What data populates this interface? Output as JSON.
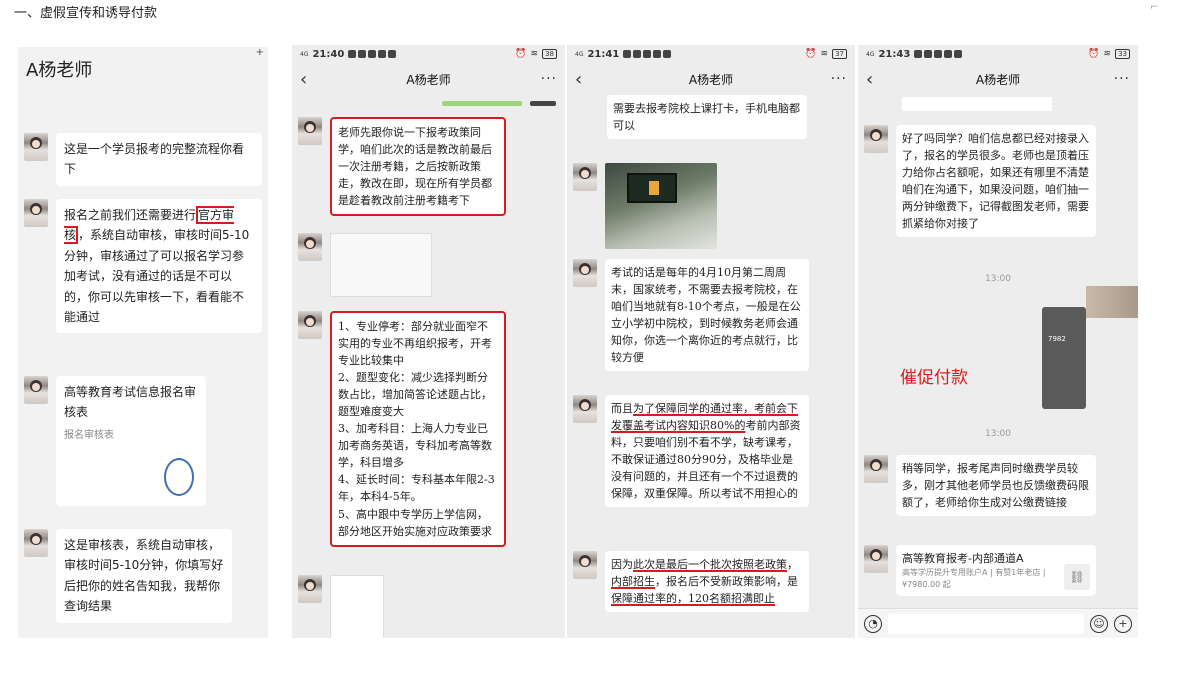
{
  "page_heading": "一、虚假宣传和诱导付款",
  "chat_title": "A杨老师",
  "panel1": {
    "messages": [
      "这是一个学员报考的完整流程你看下",
      "报名之前我们还需要进行",
      "官方审核",
      "，系统自动审核，审核时间5-10分钟，审核通过了可以报名学习参加考试，没有通过的话是不可以的，你可以先审核一下，看看能不能通过",
      "这是审核表，系统自动审核，审核时间5-10分钟，你填写好后把你的姓名告知我，我帮你查询结果"
    ],
    "card_title": "高等教育考试信息报名审核表",
    "card_sub": "报名审核表"
  },
  "panel2": {
    "time": "21:40",
    "battery": "38",
    "msg1": "老师先跟你说一下报考政策同学，咱们此次的话是教改前最后一次注册考籍，之后按新政策走，教改在即，现在所有学员都是趁着教改前注册考籍考下",
    "msg2": "1、专业停考：部分就业面窄不实用的专业不再组织报考，开考专业比较集中\n2、题型变化：减少选择判断分数占比，增加简答论述题占比，题型难度变大\n3、加考科目：上海人力专业已加考商务英语，专科加考高等数学，科目增多\n4、延长时间：专科基本年限2-3年，本科4-5年。\n5、高中跟中专学历上学信网，部分地区开始实施对应政策要求"
  },
  "panel3": {
    "time": "21:41",
    "battery": "37",
    "msg0": "需要去报考院校上课打卡，手机电脑都可以",
    "msg1": "考试的话是每年的4月10月第二周周末，国家统考，不需要去报考院校，在咱们当地就有8-10个考点，一般是在公立小学初中院校，到时候教务老师会通知你，你选一个离你近的考点就行，比较方便",
    "msg2a": "而且",
    "msg2b": "为了保障同学的通过率，考前会下发覆盖考试内容知识80%的",
    "msg2c": "考前内部资料，只要咱们别不看不学，缺考课考，不敢保证通过80分90分，及格毕业是没有问题的，并且还有一个不过退费的保障，双重保障。所以考试不用担心的",
    "msg3a": "因为",
    "msg3b": "此次是最后一个批次按照老政策",
    "msg3c": "，",
    "msg3d": "内部招生",
    "msg3e": "，报名后不受新政策影响，是",
    "msg3f": "保障通过率的，120名额招满即止"
  },
  "panel4": {
    "time": "21:43",
    "battery": "33",
    "msg1": "好了吗同学？咱们信息都已经对接录入了，报名的学员很多。老师也是顶着压力给你占名额呢，如果还有哪里不清楚咱们在沟通下，如果没问题，咱们抽一两分钟缴费下，记得截图发老师，需要抓紧给你对接了",
    "ts1": "13:00",
    "ts2": "13:00",
    "shot_code": "7982",
    "red_label": "催促付款",
    "msg2": "稍等同学，报考尾声同时缴费学员较多，刚才其他老师学员也反馈缴费码限额了，老师给你生成对公缴费链接",
    "link_title": "高等教育报考-内部通道A",
    "link_sub": "高等学历提升专用账户A | 有赞1年老店 | ¥7980.00 起"
  }
}
